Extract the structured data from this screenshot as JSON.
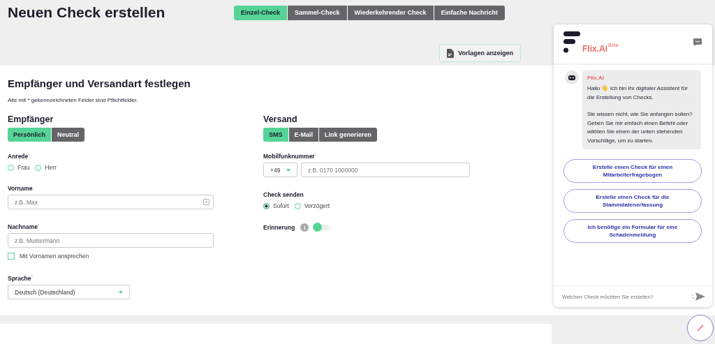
{
  "page_title": "Neuen Check erstellen",
  "mode_tabs": [
    {
      "label": "Einzel-Check",
      "selected": true
    },
    {
      "label": "Sammel-Check",
      "selected": false
    },
    {
      "label": "Wiederkehrender Check",
      "selected": false
    },
    {
      "label": "Einfache Nachricht",
      "selected": false
    }
  ],
  "templates_button": "Vorlagen anzeigen",
  "section": {
    "title": "Empfänger und Versandart festlegen",
    "note": "Alle mit * gekennzeichneten Felder sind Pflichtfelder."
  },
  "recipient": {
    "heading": "Empfänger",
    "tabs": [
      {
        "label": "Persönlich",
        "selected": true
      },
      {
        "label": "Neutral",
        "selected": false
      }
    ],
    "salutation": {
      "label": "Anrede",
      "mark": "*",
      "options": [
        {
          "label": "Frau",
          "selected": false
        },
        {
          "label": "Herr",
          "selected": false
        }
      ]
    },
    "first_name": {
      "label": "Vorname",
      "placeholder": "z.B. Max"
    },
    "last_name": {
      "label": "Nachname",
      "mark": "*",
      "placeholder": "z.B. Mustermann"
    },
    "use_first_name": {
      "label": "Mit Vornamen ansprechen",
      "checked": false
    },
    "language": {
      "label": "Sprache",
      "mark": "*",
      "value": "Deutsch (Deutschland)"
    }
  },
  "shipping": {
    "heading": "Versand",
    "tabs": [
      {
        "label": "SMS",
        "selected": true
      },
      {
        "label": "E-Mail",
        "selected": false
      },
      {
        "label": "Link generieren",
        "selected": false
      }
    ],
    "phone": {
      "label": "Mobilfunknummer",
      "mark": "*",
      "prefix": "+49",
      "placeholder": "z.B. 0170 1000000"
    },
    "send": {
      "label": "Check senden",
      "options": [
        {
          "label": "Sofort",
          "selected": true
        },
        {
          "label": "Verzögert",
          "selected": false
        }
      ]
    },
    "reminder": {
      "label": "Erinnerung",
      "info": "i",
      "on": false
    }
  },
  "chat": {
    "brand": "Flix.Ai",
    "badge": "Beta",
    "sender": "Flix.Ai",
    "message": [
      "Hallo 👋 Ich bin Ihr digitaler Assistent für die Erstellung von Checks.",
      "Sie wissen nicht, wie Sie anfangen sollen?\nGeben Sie mir einfach einen Befehl oder wählen Sie einen der unten stehenden Vorschläge, um zu starten."
    ],
    "suggestions": [
      "Erstelle einen Check für einen Mitarbeiterfragebogen",
      "Erstelle einen Check für die Stammdatenerfassung",
      "Ich benötige ein Formular für eine Schadenmeldung"
    ],
    "input_placeholder": "Welchen Check möchten Sie erstellen?"
  }
}
